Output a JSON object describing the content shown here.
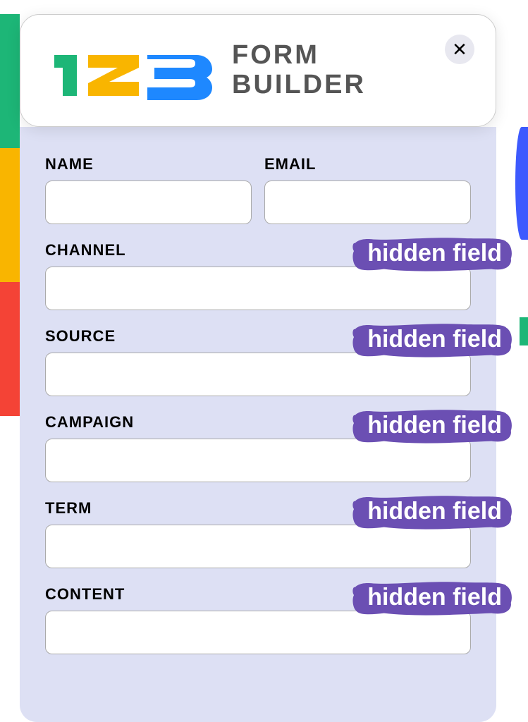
{
  "header": {
    "logo_text_line1": "FORM",
    "logo_text_line2": "BUILDER"
  },
  "fields": {
    "name_label": "NAME",
    "email_label": "EMAIL",
    "channel_label": "CHANNEL",
    "source_label": "SOURCE",
    "campaign_label": "CAMPAIGN",
    "term_label": "TERM",
    "content_label": "CONTENT"
  },
  "annotations": {
    "hidden_field": "hidden field"
  },
  "colors": {
    "brush": "#6b4fb3"
  }
}
